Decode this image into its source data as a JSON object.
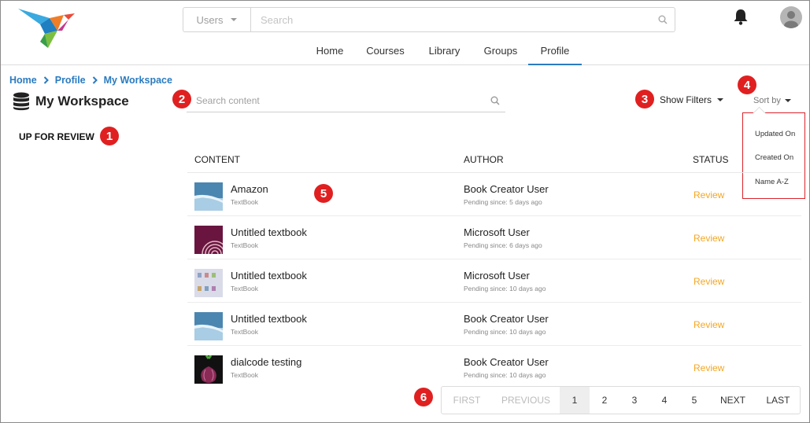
{
  "header": {
    "search_scope": "Users",
    "search_placeholder": "Search",
    "nav": [
      "Home",
      "Courses",
      "Library",
      "Groups",
      "Profile"
    ],
    "active_nav": "Profile"
  },
  "breadcrumb": [
    "Home",
    "Profile",
    "My Workspace"
  ],
  "workspace": {
    "title": "My Workspace",
    "side_item": "UP FOR REVIEW"
  },
  "content_search": {
    "placeholder": "Search content"
  },
  "filters": {
    "show_filters": "Show Filters",
    "sort_by": "Sort by",
    "sort_options": [
      "Updated On",
      "Created On",
      "Name A-Z"
    ]
  },
  "table": {
    "headers": {
      "content": "CONTENT",
      "author": "AUTHOR",
      "status": "STATUS"
    },
    "rows": [
      {
        "name": "Amazon",
        "type": "TextBook",
        "author": "Book Creator User",
        "pending": "Pending since: 5 days ago",
        "status": "Review",
        "thumb": "blue-water"
      },
      {
        "name": "Untitled textbook",
        "type": "TextBook",
        "author": "Microsoft User",
        "pending": "Pending since: 6 days ago",
        "status": "Review",
        "thumb": "onion"
      },
      {
        "name": "Untitled textbook",
        "type": "TextBook",
        "author": "Microsoft User",
        "pending": "Pending since: 10 days ago",
        "status": "Review",
        "thumb": "collage"
      },
      {
        "name": "Untitled textbook",
        "type": "TextBook",
        "author": "Book Creator User",
        "pending": "Pending since: 10 days ago",
        "status": "Review",
        "thumb": "blue-water"
      },
      {
        "name": "dialcode testing",
        "type": "TextBook",
        "author": "Book Creator User",
        "pending": "Pending since: 10 days ago",
        "status": "Review",
        "thumb": "onion-dark"
      }
    ]
  },
  "pagination": {
    "first": "FIRST",
    "previous": "PREVIOUS",
    "pages": [
      "1",
      "2",
      "3",
      "4",
      "5"
    ],
    "current": "1",
    "next": "NEXT",
    "last": "LAST"
  },
  "markers": [
    "1",
    "2",
    "3",
    "4",
    "5",
    "6"
  ],
  "colors": {
    "link": "#2a7bc0",
    "review": "#f5a623",
    "marker": "#e02020"
  }
}
